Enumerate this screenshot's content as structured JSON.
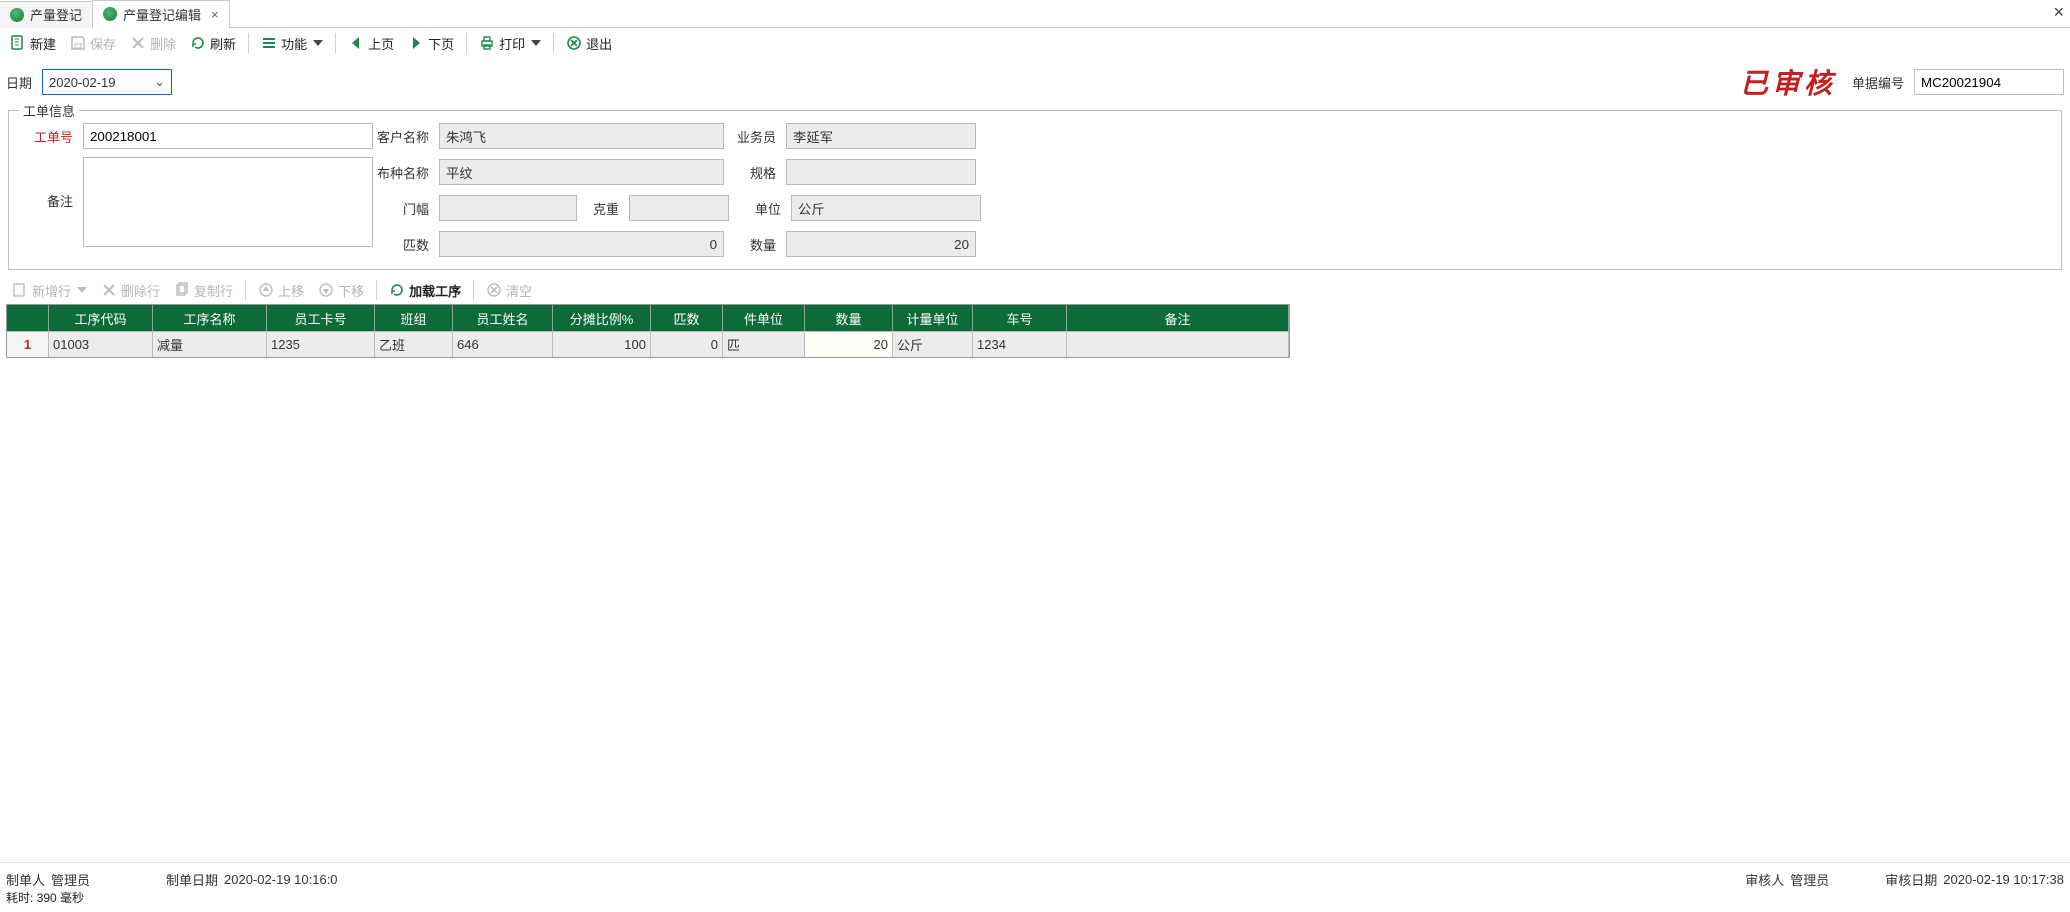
{
  "tabs": {
    "list": [
      {
        "label": "产量登记",
        "closable": false
      },
      {
        "label": "产量登记编辑",
        "closable": true
      }
    ],
    "active_index": 1
  },
  "toolbar": {
    "new": "新建",
    "save": "保存",
    "delete": "删除",
    "refresh": "刷新",
    "function": "功能",
    "prev": "上页",
    "next": "下页",
    "print": "打印",
    "exit": "退出"
  },
  "header": {
    "date_label": "日期",
    "date_value": "2020-02-19",
    "approved_text": "已审核",
    "doc_no_label": "单据编号",
    "doc_no_value": "MC20021904"
  },
  "work_order": {
    "legend": "工单信息",
    "labels": {
      "order_no": "工单号",
      "customer": "客户名称",
      "salesman": "业务员",
      "fabric": "布种名称",
      "spec": "规格",
      "width": "门幅",
      "weight": "克重",
      "unit": "单位",
      "pcs": "匹数",
      "qty": "数量",
      "remark": "备注"
    },
    "values": {
      "order_no": "200218001",
      "customer": "朱鸿飞",
      "salesman": "李延军",
      "fabric": "平纹",
      "spec": "",
      "width": "",
      "weight": "",
      "unit": "公斤",
      "pcs": "0",
      "qty": "20",
      "remark": ""
    }
  },
  "subtoolbar": {
    "add_row": "新增行",
    "delete_row": "删除行",
    "copy_row": "复制行",
    "move_up": "上移",
    "move_down": "下移",
    "load_process": "加载工序",
    "clear": "清空"
  },
  "grid": {
    "headers": {
      "proc_code": "工序代码",
      "proc_name": "工序名称",
      "emp_card": "员工卡号",
      "team": "班组",
      "emp_name": "员工姓名",
      "share_pct": "分摊比例%",
      "pcs": "匹数",
      "piece_unit": "件单位",
      "qty": "数量",
      "measure_unit": "计量单位",
      "car_no": "车号",
      "remark": "备注"
    },
    "rows": [
      {
        "row_num": "1",
        "proc_code": "01003",
        "proc_name": "减量",
        "emp_card": "1235",
        "team": "乙班",
        "emp_name": "646",
        "share_pct": "100",
        "pcs": "0",
        "piece_unit": "匹",
        "qty": "20",
        "measure_unit": "公斤",
        "car_no": "1234",
        "remark": ""
      }
    ]
  },
  "footer": {
    "preparer_label": "制单人",
    "preparer": "管理员",
    "prepare_date_label": "制单日期",
    "prepare_date": "2020-02-19 10:16:0",
    "auditor_label": "审核人",
    "auditor": "管理员",
    "audit_date_label": "审核日期",
    "audit_date": "2020-02-19 10:17:38",
    "elapsed": "耗时: 390 毫秒"
  }
}
